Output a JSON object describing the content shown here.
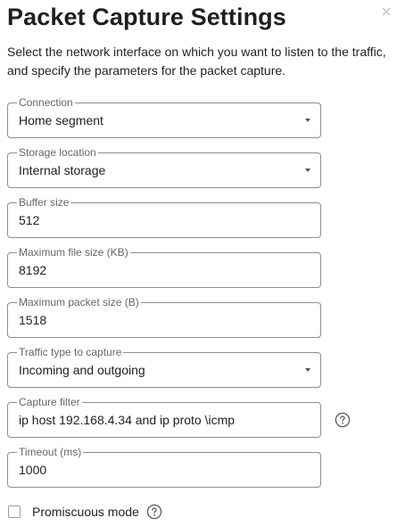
{
  "dialog": {
    "title": "Packet Capture Settings",
    "description": "Select the network interface on which you want to listen to the traffic, and specify the parameters for the packet capture.",
    "close_icon": "close-icon"
  },
  "fields": {
    "connection": {
      "label": "Connection",
      "value": "Home segment",
      "type": "select"
    },
    "storage_location": {
      "label": "Storage location",
      "value": "Internal storage",
      "type": "select"
    },
    "buffer_size": {
      "label": "Buffer size",
      "value": "512",
      "type": "input"
    },
    "max_file_size": {
      "label": "Maximum file size (KB)",
      "value": "8192",
      "type": "input"
    },
    "max_packet_size": {
      "label": "Maximum packet size (B)",
      "value": "1518",
      "type": "input"
    },
    "traffic_type": {
      "label": "Traffic type to capture",
      "value": "Incoming and outgoing",
      "type": "select"
    },
    "capture_filter": {
      "label": "Capture filter",
      "value": "ip host 192.168.4.34 and ip proto \\icmp",
      "type": "input",
      "help_icon": "help-circle-icon"
    },
    "timeout": {
      "label": "Timeout (ms)",
      "value": "1000",
      "type": "input"
    }
  },
  "promiscuous": {
    "label": "Promiscuous mode",
    "checked": false,
    "help_icon": "help-circle-icon"
  },
  "colors": {
    "border": "#8e8e8e",
    "label": "#666666",
    "text": "#202124"
  }
}
